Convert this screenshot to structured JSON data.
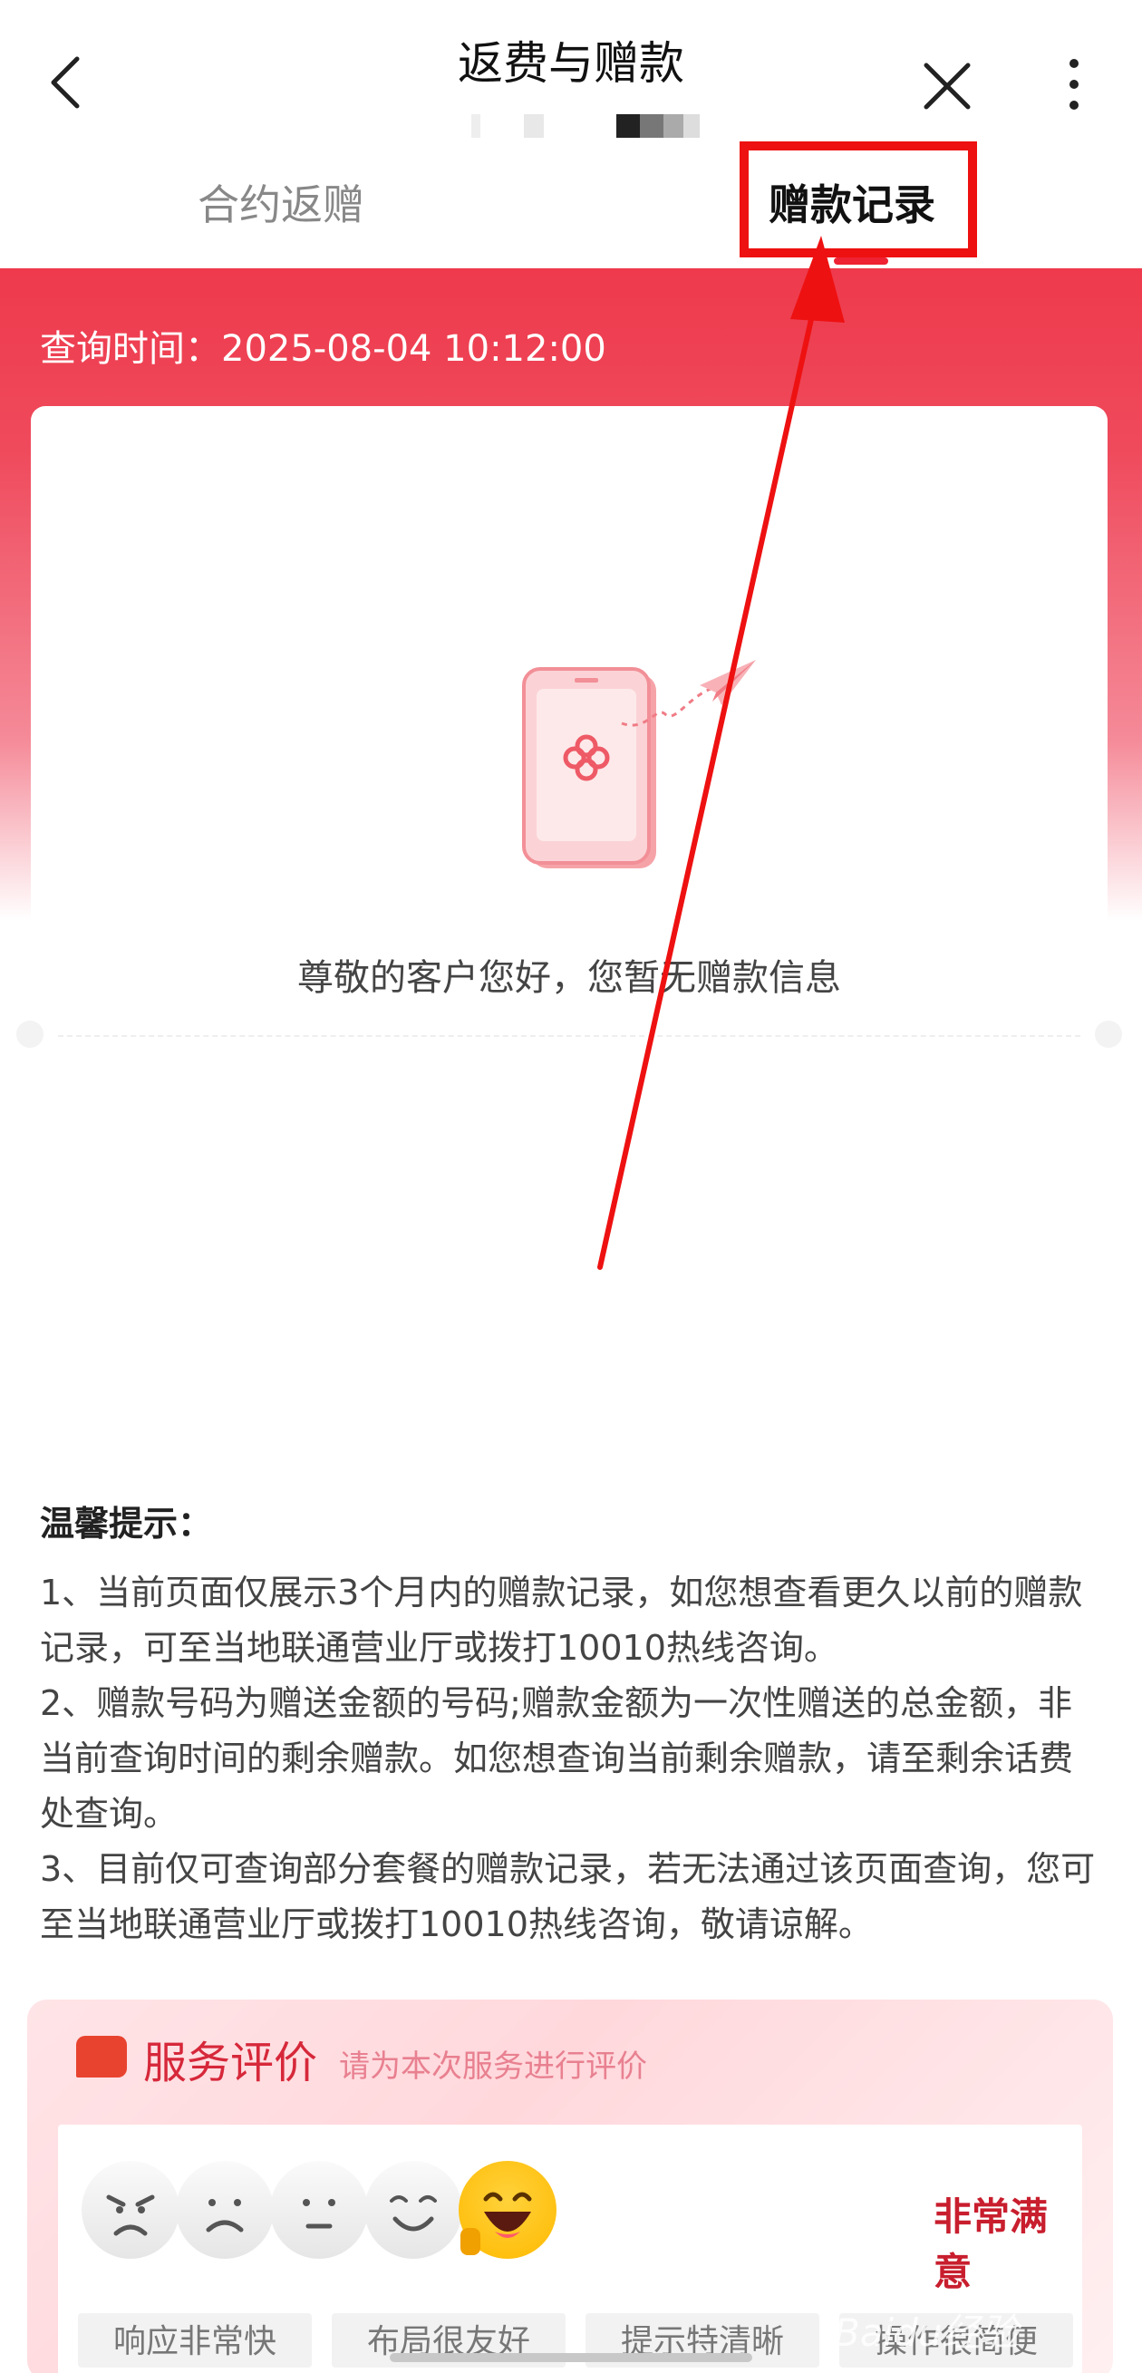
{
  "header": {
    "title": "返费与赠款",
    "back_icon": "chevron-left-icon",
    "close_icon": "close-icon",
    "more_icon": "more-vertical-icon"
  },
  "tabs": [
    {
      "label": "合约返赠",
      "active": false
    },
    {
      "label": "赠款记录",
      "active": true
    }
  ],
  "query": {
    "label": "查询时间：",
    "time": "2025-08-04 10:12:00"
  },
  "empty_state": {
    "message": "尊敬的客户您好，您暂无赠款信息",
    "illustration": "phone-with-paper-plane"
  },
  "tips": {
    "title": "温馨提示：",
    "items": [
      "1、当前页面仅展示3个月内的赠款记录，如您想查看更久以前的赠款记录，可至当地联通营业厅或拨打10010热线咨询。",
      "2、赠款号码为赠送金额的号码;赠款金额为一次性赠送的总金额，非当前查询时间的剩余赠款。如您想查询当前剩余赠款，请至剩余话费处查询。",
      "3、目前仅可查询部分套餐的赠款记录，若无法通过该页面查询，您可至当地联通营业厅或拨打10010热线咨询，敬请谅解。"
    ]
  },
  "rating": {
    "title": "服务评价",
    "hint": "请为本次服务进行评价",
    "selected_label": "非常满意",
    "faces": [
      "angry",
      "sad",
      "neutral",
      "smile",
      "very-happy"
    ],
    "tags": [
      "响应非常快",
      "布局很友好",
      "提示特清晰",
      "操作很简便"
    ]
  },
  "watermark": "Baidu经验",
  "colors": {
    "brand_red": "#ee3a4c",
    "annotation_red": "#ee1111"
  }
}
